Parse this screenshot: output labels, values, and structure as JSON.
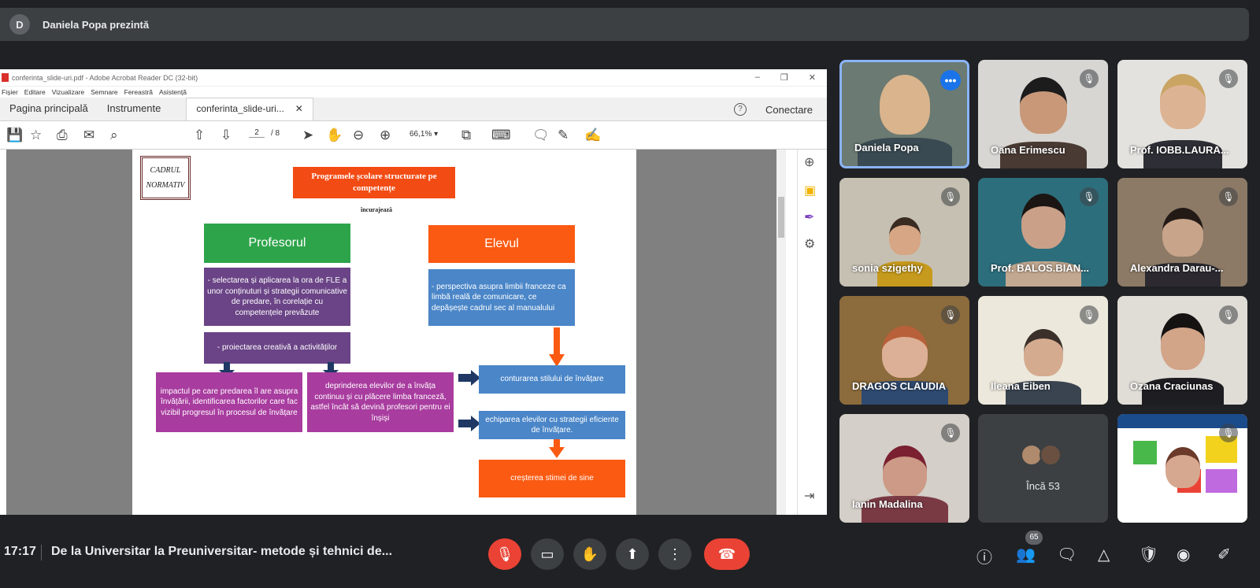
{
  "presenter": {
    "initial": "D",
    "label": "Daniela Popa prezintă"
  },
  "acrobat": {
    "window_title": "conferinta_slide-uri.pdf - Adobe Acrobat Reader DC (32-bit)",
    "window_controls": [
      "–",
      "❐",
      "✕"
    ],
    "menu": [
      "Fișier",
      "Editare",
      "Vizualizare",
      "Semnare",
      "Fereastră",
      "Asistență"
    ],
    "tabs": {
      "home": "Pagina principală",
      "tools": "Instrumente",
      "doc": "conferinta_slide-uri...",
      "close": "✕"
    },
    "help": "?",
    "connect": "Conectare",
    "page_current": "2",
    "page_total": "/ 8",
    "zoom": "66,1%"
  },
  "slide": {
    "cadrul_line1": "CADRUL",
    "cadrul_line2": "NORMATIV",
    "title": "Programele școlare structurate pe competențe",
    "incurajeaza": "încurajează",
    "profesorul": "Profesorul",
    "elevul": "Elevul",
    "prof_box": "- selectarea și aplicarea la ora de FLE a unor conținuturi și strategii comunicative de predare, în corelație cu competențele prevăzute",
    "elev_box": "- perspectiva asupra limbii franceze ca limbă reală de comunicare, ce depășește cadrul sec al manualului",
    "proiectare": "- proiectarea creativă a activităților",
    "impact": "impactul pe care predarea îl are asupra învățării, identificarea factorilor care fac vizibil progresul în procesul de învățare",
    "deprindere": "deprinderea elevilor de a învăța continuu și cu plăcere limba franceză, astfel încât să devină profesori pentru ei înșiși",
    "conturarea": "conturarea stilului de învățare",
    "echiparea": "echiparea elevilor cu strategii eficiente de învățare.",
    "cresterea": "creșterea stimei de sine"
  },
  "participants": [
    {
      "name": "Daniela Popa"
    },
    {
      "name": "Oana Erimescu"
    },
    {
      "name": "Prof. IOBB.LAURA..."
    },
    {
      "name": "sonia szigethy"
    },
    {
      "name": "Prof. BALOS.BIAN..."
    },
    {
      "name": "Alexandra Darau-..."
    },
    {
      "name": "DRAGOS CLAUDIA"
    },
    {
      "name": "Ileana Eiben"
    },
    {
      "name": "Ozana Craciunas"
    },
    {
      "name": "Ianin Madalina"
    }
  ],
  "more": {
    "label": "Încă 53"
  },
  "meeting": {
    "time": "17:17",
    "title": "De la Universitar la Preuniversitar- metode și tehnici de..."
  },
  "people_count": "65",
  "colors": {
    "green": "#2ea44a",
    "orange": "#fb5a12",
    "purple": "#6a4486",
    "blue": "#4a86c8",
    "magenta": "#a83c9f",
    "red": "#ea4335",
    "navy": "#1f3864"
  }
}
